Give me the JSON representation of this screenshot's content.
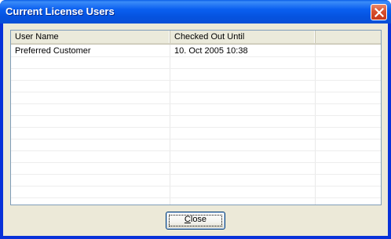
{
  "window": {
    "title": "Current License Users",
    "titlebar_color": "#0a5fe8",
    "close_icon": "close-icon"
  },
  "listview": {
    "columns": [
      "User Name",
      "Checked Out Until",
      ""
    ],
    "rows": [
      {
        "user": "Preferred Customer",
        "until": "10. Oct 2005 10:38"
      }
    ]
  },
  "buttons": {
    "close_mnemonic": "C",
    "close_rest": "lose"
  }
}
